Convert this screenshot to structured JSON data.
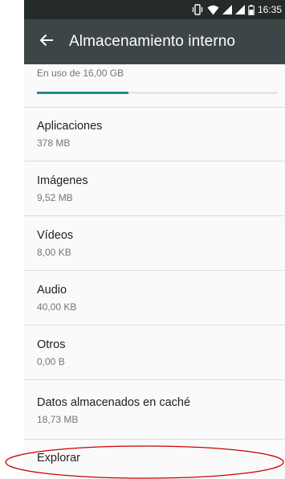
{
  "status_bar": {
    "time": "16:35",
    "icons": [
      "vibrate-icon",
      "wifi-icon",
      "signal-icon",
      "signal-icon",
      "battery-icon"
    ]
  },
  "app_bar": {
    "back_icon": "arrow-back-icon",
    "title": "Almacenamiento interno"
  },
  "usage": {
    "label": "En uso de 16,00 GB",
    "progress_fraction": 0.38,
    "bar_color": "#1e8f86"
  },
  "items": [
    {
      "title": "Aplicaciones",
      "size": "378 MB"
    },
    {
      "title": "Imágenes",
      "size": "9,52 MB"
    },
    {
      "title": "Vídeos",
      "size": "8,00 KB"
    },
    {
      "title": "Audio",
      "size": "40,00 KB"
    },
    {
      "title": "Otros",
      "size": "0,00 B"
    },
    {
      "title": "Datos almacenados en caché",
      "size": "18,73 MB"
    }
  ],
  "explore": {
    "title": "Explorar"
  },
  "annotation": {
    "shape": "ellipse",
    "color": "#cc0000",
    "target": "explore"
  },
  "colors": {
    "status_bar": "#252a2b",
    "app_bar": "#3d4547",
    "background": "#fafafa"
  }
}
